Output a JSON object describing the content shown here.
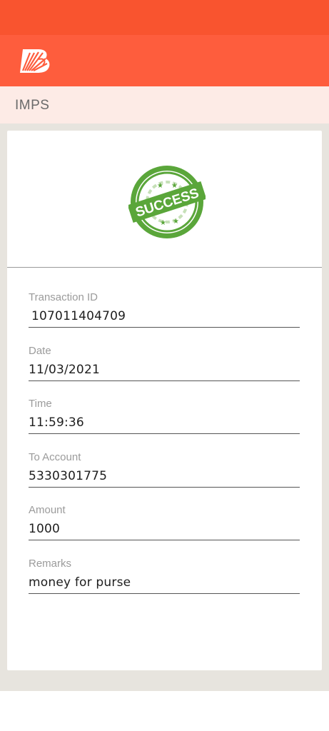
{
  "header": {
    "brand_color": "#fe5d3d",
    "status_bar_color": "#f9542f",
    "logo_icon": "bank-of-baroda-logo-icon"
  },
  "subheader": {
    "title": "IMPS"
  },
  "stamp": {
    "text": "SUCCESS",
    "color": "#5aa63a"
  },
  "fields": [
    {
      "label": "Transaction ID",
      "value": "107011404709"
    },
    {
      "label": "Date",
      "value": "11/03/2021"
    },
    {
      "label": "Time",
      "value": "11:59:36"
    },
    {
      "label": "To Account",
      "value": "5330301775"
    },
    {
      "label": "Amount",
      "value": "1000"
    },
    {
      "label": "Remarks",
      "value": "money for purse"
    }
  ]
}
